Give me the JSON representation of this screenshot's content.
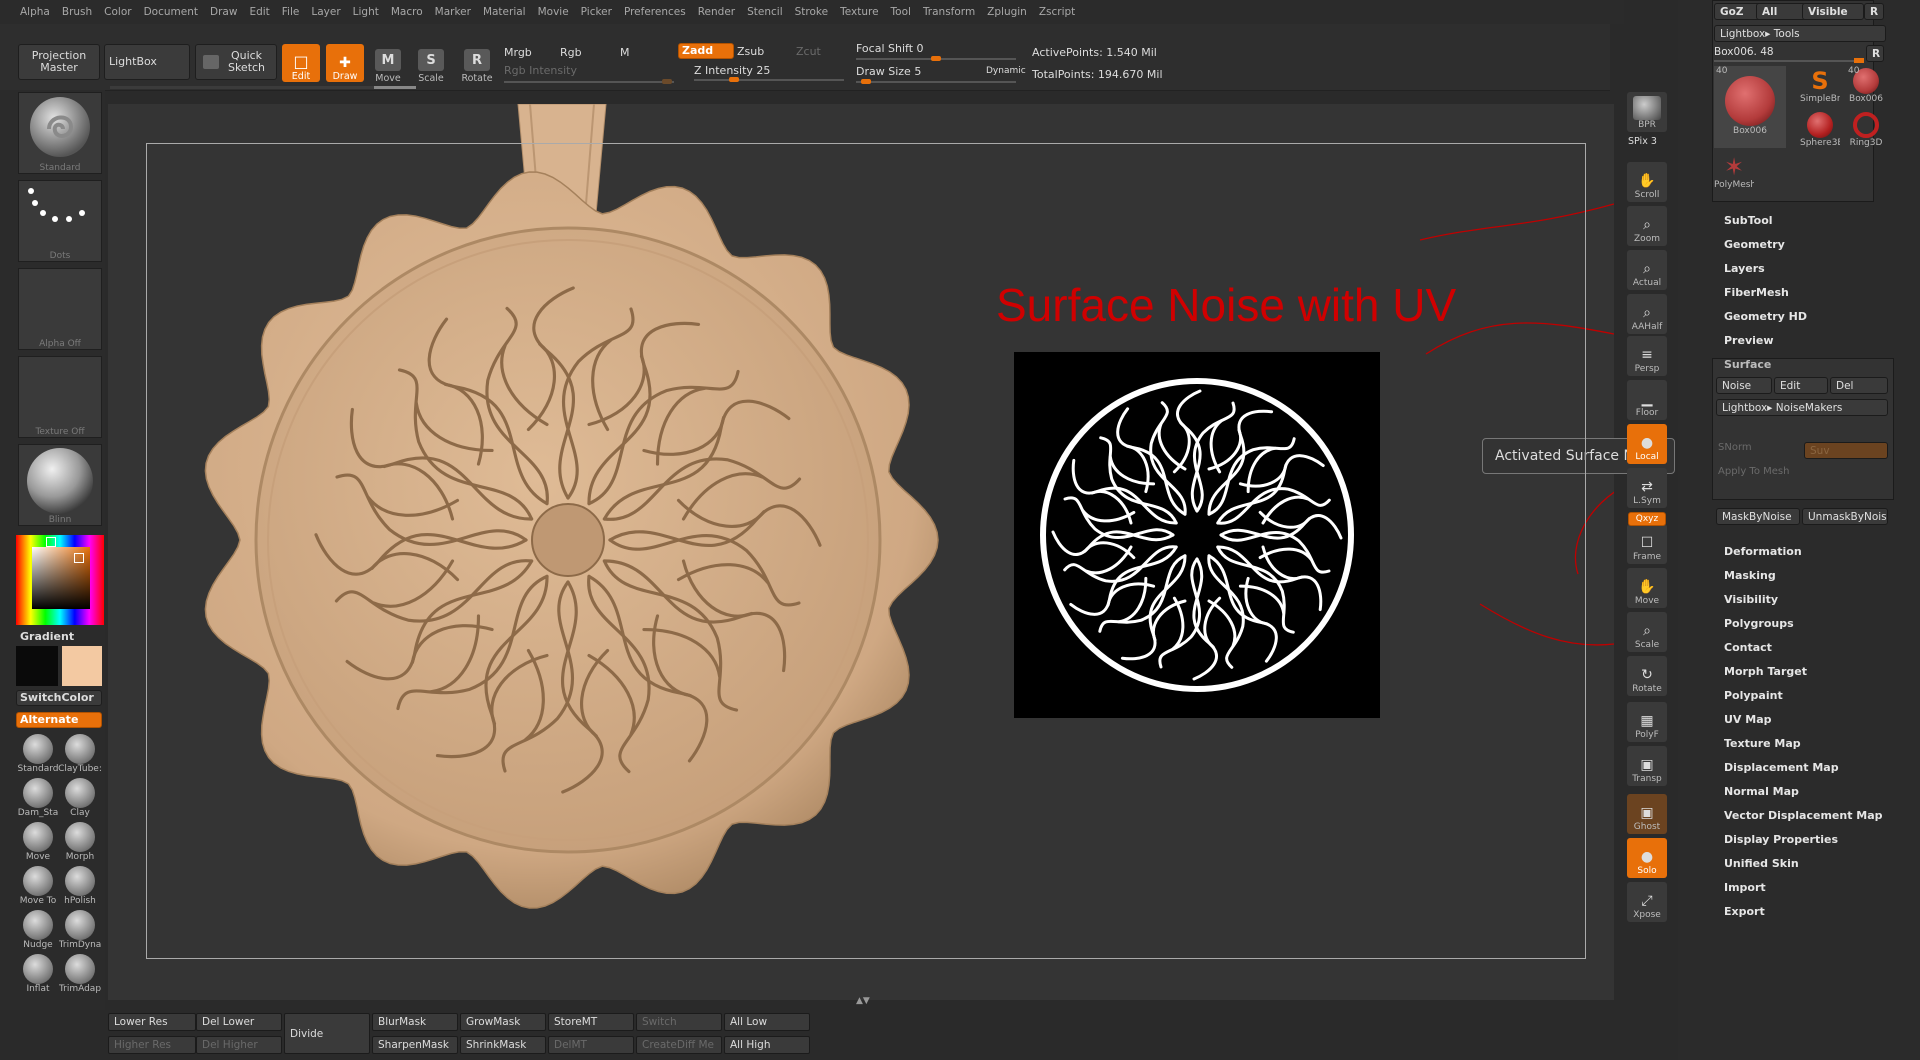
{
  "menubar": [
    "Alpha",
    "Brush",
    "Color",
    "Document",
    "Draw",
    "Edit",
    "File",
    "Layer",
    "Light",
    "Macro",
    "Marker",
    "Material",
    "Movie",
    "Picker",
    "Preferences",
    "Render",
    "Stencil",
    "Stroke",
    "Texture",
    "Tool",
    "Transform",
    "Zplugin",
    "Zscript"
  ],
  "toolbar": {
    "projection_master": "Projection Master",
    "lightbox": "LightBox",
    "quick_sketch": "Quick Sketch",
    "edit": "Edit",
    "draw": "Draw",
    "move": "Move",
    "scale": "Scale",
    "rotate": "Rotate",
    "mrgb": "Mrgb",
    "rgb": "Rgb",
    "m": "M",
    "rgb_intensity": "Rgb Intensity",
    "zadd": "Zadd",
    "zsub": "Zsub",
    "zcut": "Zcut",
    "z_intensity_label": "Z Intensity",
    "z_intensity_value": "25",
    "z_intensity_level": 0.25,
    "focal_shift_label": "Focal Shift",
    "focal_shift_value": "0",
    "focal_shift_level": 0.5,
    "draw_size_label": "Draw Size",
    "draw_size_value": "5",
    "draw_size_level": 0.03,
    "dynamic": "Dynamic",
    "active_points": "ActivePoints: 1.540  Mil",
    "total_points": "TotalPoints: 194.670  Mil"
  },
  "leftshelf": {
    "brush": "Standard",
    "stroke": "Dots",
    "alpha": "Alpha Off",
    "texture": "Texture Off",
    "material": "Blinn",
    "gradient": "Gradient",
    "switchcolor": "SwitchColor",
    "alternate": "Alternate",
    "primary_color": "#0a0a0a",
    "secondary_color": "#f3c9a2",
    "brushes": [
      "Standard",
      "ClayTube:",
      "Dam_Sta",
      "Clay",
      "Move",
      "Morph",
      "Move To",
      "hPolish",
      "Nudge",
      "TrimDyna",
      "Inflat",
      "TrimAdap"
    ]
  },
  "canvas": {
    "annotation_title": "Surface Noise with UV",
    "annotation_color": "#d00000",
    "tooltip": "Activated Surface Noise",
    "model_color": "#d8b38f"
  },
  "rstrip": {
    "bpr": "BPR",
    "spix": "SPix 3",
    "buttons": [
      "Scroll",
      "Zoom",
      "Actual",
      "AAHalf",
      "Persp",
      "Floor",
      "Local",
      "L.Sym",
      "Frame",
      "Move",
      "Scale",
      "Rotate",
      "PolyF",
      "Transp",
      "Ghost",
      "Solo",
      "Xpose"
    ],
    "xyz": "Qxyz"
  },
  "rpanel": {
    "goz": "GoZ",
    "all": "All",
    "visible": "Visible",
    "r": "R",
    "lightbox_tools": "Lightbox▸ Tools",
    "tool_name": "Box006. 48",
    "tools": [
      {
        "name": "Box006",
        "count": "40"
      },
      {
        "name": "SimpleBr"
      },
      {
        "name": "Box006",
        "count": "40"
      },
      {
        "name": "Sphere3E"
      },
      {
        "name": "Ring3D"
      },
      {
        "name": "PolyMesh"
      }
    ],
    "menu_top": [
      "SubTool",
      "Geometry",
      "Layers",
      "FiberMesh",
      "Geometry HD",
      "Preview"
    ],
    "surface": "Surface",
    "noise": "Noise",
    "edit": "Edit",
    "del": "Del",
    "lightbox_noisemakers": "Lightbox▸ NoiseMakers",
    "snorm": "SNorm",
    "suv": "Suv",
    "apply_to_mesh": "Apply To Mesh",
    "mask_by_noise": "MaskByNoise",
    "unmask_by_noise": "UnmaskByNois",
    "menu_bottom": [
      "Deformation",
      "Masking",
      "Visibility",
      "Polygroups",
      "Contact",
      "Morph Target",
      "Polypaint",
      "UV Map",
      "Texture Map",
      "Displacement Map",
      "Normal Map",
      "Vector Displacement Map",
      "Display Properties",
      "Unified Skin",
      "Import",
      "Export"
    ]
  },
  "bottombar": {
    "lower_res": "Lower Res",
    "higher_res": "Higher Res",
    "del_lower": "Del Lower",
    "del_higher": "Del Higher",
    "divide": "Divide",
    "blur_mask": "BlurMask",
    "sharpen_mask": "SharpenMask",
    "grow_mask": "GrowMask",
    "shrink_mask": "ShrinkMask",
    "store_mt": "StoreMT",
    "del_mt": "DelMT",
    "switch": "Switch",
    "create_diff": "CreateDiff Me",
    "all_low": "All Low",
    "all_high": "All High"
  }
}
